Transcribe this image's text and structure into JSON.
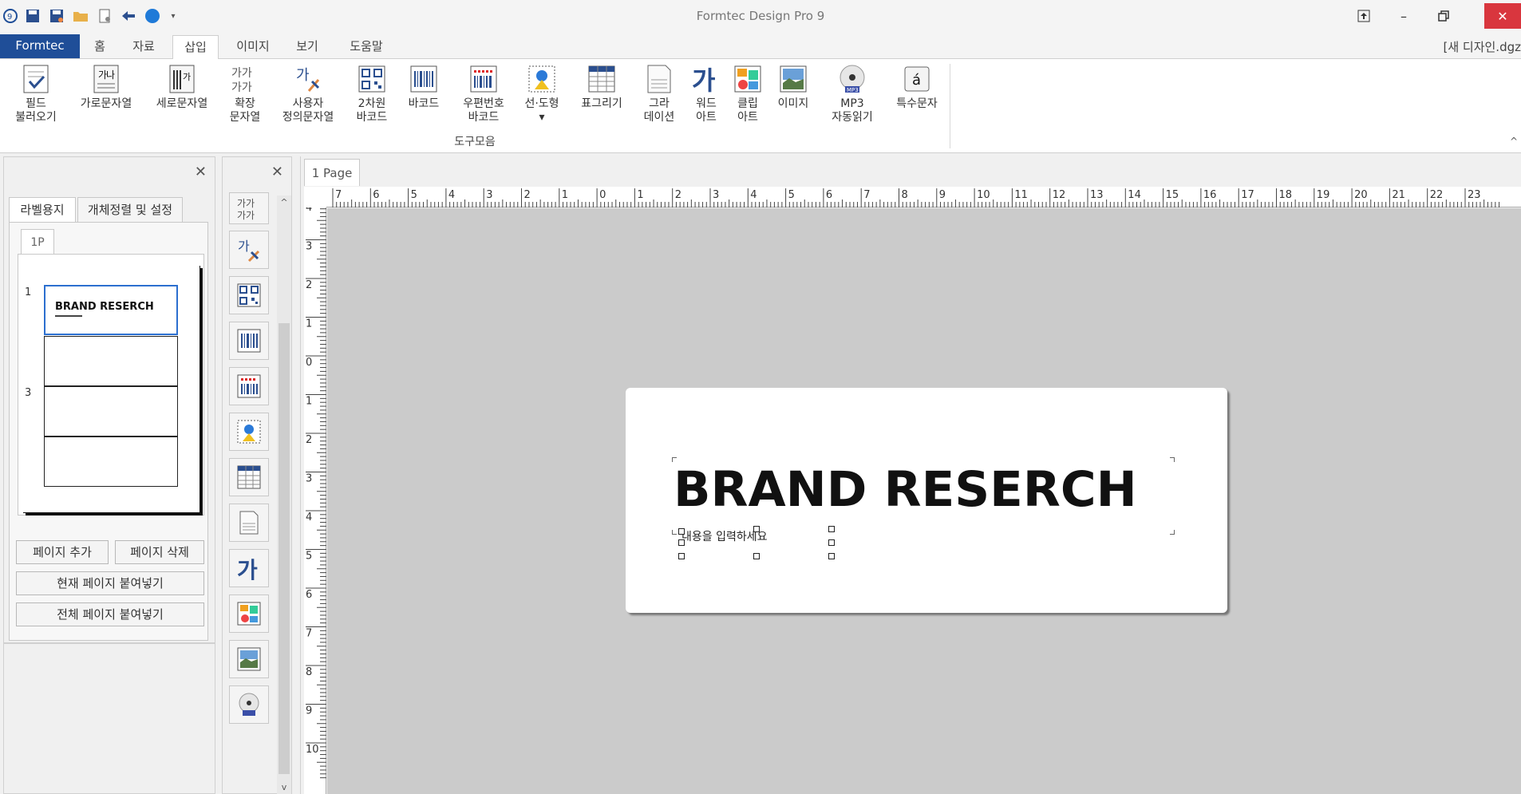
{
  "window": {
    "title": "Formtec Design Pro 9",
    "document_name": "[새 디자인.dgz"
  },
  "tabs": [
    {
      "label": "Formtec",
      "active": false
    },
    {
      "label": "홈",
      "active": false
    },
    {
      "label": "자료",
      "active": false
    },
    {
      "label": "삽입",
      "active": true
    },
    {
      "label": "이미지",
      "active": false
    },
    {
      "label": "보기",
      "active": false
    },
    {
      "label": "도움말",
      "active": false
    }
  ],
  "ribbon": {
    "group_label": "도구모음",
    "items": [
      {
        "label": "필드\n불러오기",
        "icon": "field-load-icon"
      },
      {
        "label": "가로문자열",
        "icon": "horizontal-text-icon"
      },
      {
        "label": "세로문자열",
        "icon": "vertical-text-icon"
      },
      {
        "label": "확장\n문자열",
        "icon": "extended-text-icon"
      },
      {
        "label": "사용자\n정의문자열",
        "icon": "custom-text-icon"
      },
      {
        "label": "2차원\n바코드",
        "icon": "qr-code-icon"
      },
      {
        "label": "바코드",
        "icon": "barcode-icon"
      },
      {
        "label": "우편번호\n바코드",
        "icon": "postal-barcode-icon"
      },
      {
        "label": "선·도형\n▾",
        "icon": "shape-icon"
      },
      {
        "label": "표그리기",
        "icon": "table-icon"
      },
      {
        "label": "그라\n데이션",
        "icon": "gradient-icon"
      },
      {
        "label": "워드\n아트",
        "icon": "word-art-icon"
      },
      {
        "label": "클립\n아트",
        "icon": "clip-art-icon"
      },
      {
        "label": "이미지",
        "icon": "image-icon"
      },
      {
        "label": "MP3\n자동읽기",
        "icon": "mp3-icon"
      },
      {
        "label": "특수문자",
        "icon": "special-char-icon"
      }
    ]
  },
  "left_panel": {
    "tabs": [
      "라벨용지",
      "개체정렬 및 설정"
    ],
    "page_tab": "1P",
    "row_numbers": [
      "1",
      "3"
    ],
    "thumbnail_title": "BRAND RESERCH",
    "buttons": {
      "add_page": "페이지 추가",
      "delete_page": "페이지 삭제",
      "paste_current": "현재 페이지 붙여넣기",
      "paste_all": "전체 페이지 붙여넣기"
    }
  },
  "palette": {
    "icons": [
      "extended-text-icon",
      "custom-text-icon",
      "qr-code-icon",
      "barcode-icon",
      "postal-barcode-icon",
      "shape-icon",
      "table-icon",
      "gradient-icon",
      "word-art-icon",
      "clip-art-icon",
      "image-icon",
      "mp3-icon"
    ]
  },
  "canvas": {
    "page_tab": "1 Page",
    "label_title": "BRAND RESERCH",
    "label_placeholder": "내용을 입력하세요",
    "h_ruler_numbers": [
      "7",
      "6",
      "5",
      "4",
      "3",
      "2",
      "1",
      "0",
      "1",
      "2",
      "3",
      "4",
      "5",
      "6",
      "7",
      "8",
      "9",
      "10",
      "11",
      "12",
      "13",
      "14",
      "15",
      "16",
      "17",
      "18",
      "19",
      "20",
      "21",
      "22",
      "23"
    ],
    "v_ruler_numbers": [
      "4",
      "3",
      "2",
      "1",
      "0",
      "1",
      "2",
      "3",
      "4",
      "5",
      "6",
      "7",
      "8",
      "9",
      "10"
    ]
  },
  "colors": {
    "accent": "#1f4e98",
    "close": "#d9363e",
    "workspace": "#cbcbcb"
  }
}
